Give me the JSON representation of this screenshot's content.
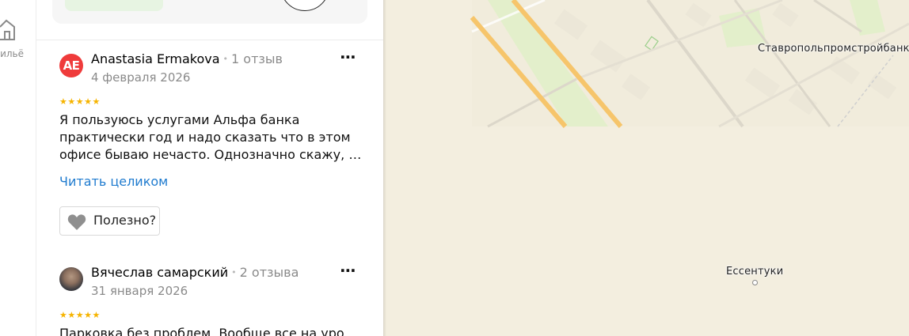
{
  "rail": {
    "label": "ильё"
  },
  "reviews": [
    {
      "initials": "AE",
      "author": "Anastasia Ermakova",
      "separator": "•",
      "count": "1 отзыв",
      "date": "4 февраля 2026",
      "stars": "★★★★★",
      "rating": 5,
      "lines": [
        "Я пользуюсь услугами Альфа банка",
        "практически год и надо сказать что в этом",
        "офисе бываю нечасто. Однозначно скажу, что..."
      ],
      "read_more": "Читать целиком",
      "helpful": "Полезно?",
      "more": "⋯"
    },
    {
      "author": "Вячеслав самарский",
      "separator": "•",
      "count": "2 отзыва",
      "date": "31 января 2026",
      "stars": "★★★★★",
      "rating": 5,
      "lines": [
        "Парковка без проблем. Вообще все на уровне"
      ],
      "more": "⋯"
    }
  ],
  "map": {
    "labels": {
      "bank": "Ставропольпромстройбанк",
      "city": "Ессентуки"
    },
    "colors": {
      "background": "#f3eedf",
      "road_major": "#f6c56b",
      "park": "#e3efcb",
      "block": "#ece7d8"
    }
  }
}
